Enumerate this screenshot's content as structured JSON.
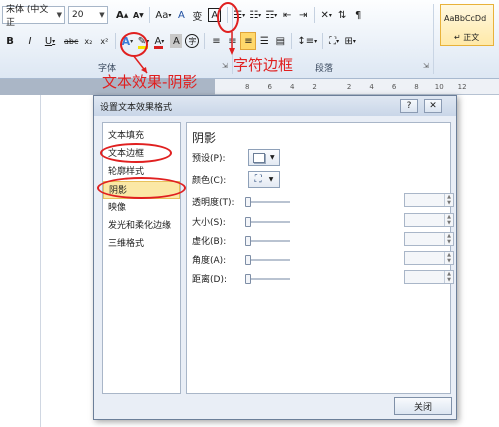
{
  "ribbon": {
    "font_name": "宋体 (中文正",
    "font_size": "20",
    "grow_font": "A",
    "shrink_font": "A",
    "clear_format": "A",
    "aa_case": "Aa",
    "phonetic": "变",
    "char_border": "A",
    "bold": "B",
    "italic": "I",
    "underline": "U",
    "strikethrough": "abc",
    "subscript": "x₂",
    "superscript": "x²",
    "text_effect": "A",
    "font_color": "A",
    "char_shading": "A",
    "enclosed_char": "字",
    "group_font": "字体",
    "group_paragraph": "段落",
    "style_sample": "AaBbCcDd",
    "style_name": "↵ 正文"
  },
  "annotations": {
    "text_effect": "文本效果-阴影",
    "char_border": "字符边框"
  },
  "ruler_marks": [
    "8",
    "6",
    "4",
    "2",
    "2",
    "4",
    "6",
    "8",
    "10",
    "12"
  ],
  "dialog": {
    "title": "设置文本效果格式",
    "help": "?",
    "close_x": "✕",
    "nav": [
      "文本填充",
      "文本边框",
      "轮廓样式",
      "阴影",
      "映像",
      "发光和柔化边缘",
      "三维格式"
    ],
    "selected_index": 3,
    "panel_title": "阴影",
    "preset_label": "预设(P):",
    "color_label": "颜色(C):",
    "fields": [
      {
        "label": "透明度(T):",
        "value": ""
      },
      {
        "label": "大小(S):",
        "value": ""
      },
      {
        "label": "虚化(B):",
        "value": ""
      },
      {
        "label": "角度(A):",
        "value": ""
      },
      {
        "label": "距离(D):",
        "value": ""
      }
    ],
    "close_button": "关闭"
  },
  "colors": {
    "annotation": "#e02020",
    "selected_item": "#fbe8a6",
    "font_color_bar": "#d92020",
    "highlight_bar": "#f5e400"
  }
}
